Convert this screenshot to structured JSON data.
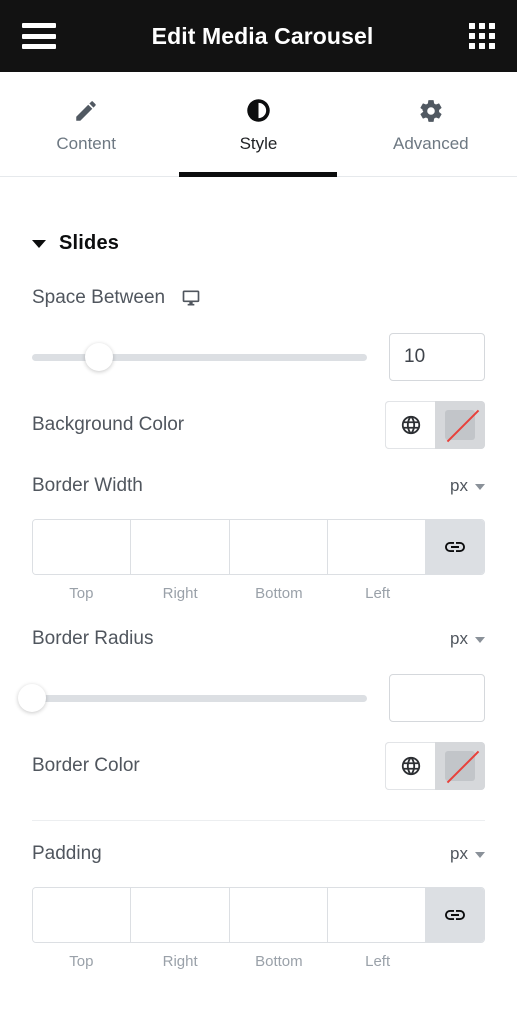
{
  "topbar": {
    "menu_icon": "hamburger-icon",
    "title": "Edit Media Carousel",
    "apps_icon": "grid-apps-icon"
  },
  "tabs": [
    {
      "id": "content",
      "label": "Content",
      "icon": "pencil-icon",
      "active": false
    },
    {
      "id": "style",
      "label": "Style",
      "icon": "contrast-half-circle-icon",
      "active": true
    },
    {
      "id": "advanced",
      "label": "Advanced",
      "icon": "gear-icon",
      "active": false
    }
  ],
  "section": {
    "title": "Slides",
    "expanded": true,
    "caret_icon": "caret-down-icon"
  },
  "controls": {
    "space_between": {
      "label": "Space Between",
      "device_icon": "desktop-monitor-icon",
      "value": "10",
      "placeholder": "",
      "slider_percent": 20
    },
    "background_color": {
      "label": "Background Color",
      "globe_icon": "globe-icon",
      "swatch_icon": "no-color-swatch-icon",
      "value": ""
    },
    "border_width": {
      "label": "Border Width",
      "unit": "px",
      "unit_chevron_icon": "chevron-down-icon",
      "fields": [
        {
          "name": "top",
          "label": "Top",
          "value": "",
          "placeholder": ""
        },
        {
          "name": "right",
          "label": "Right",
          "value": "",
          "placeholder": ""
        },
        {
          "name": "bottom",
          "label": "Bottom",
          "value": "",
          "placeholder": ""
        },
        {
          "name": "left",
          "label": "Left",
          "value": "",
          "placeholder": ""
        }
      ],
      "link_icon": "link-chain-icon"
    },
    "border_radius": {
      "label": "Border Radius",
      "unit": "px",
      "unit_chevron_icon": "chevron-down-icon",
      "value": "",
      "placeholder": "",
      "slider_percent": 0
    },
    "border_color": {
      "label": "Border Color",
      "globe_icon": "globe-icon",
      "swatch_icon": "no-color-swatch-icon",
      "value": ""
    },
    "padding": {
      "label": "Padding",
      "unit": "px",
      "unit_chevron_icon": "chevron-down-icon",
      "fields": [
        {
          "name": "top",
          "label": "Top",
          "value": "",
          "placeholder": ""
        },
        {
          "name": "right",
          "label": "Right",
          "value": "",
          "placeholder": ""
        },
        {
          "name": "bottom",
          "label": "Bottom",
          "value": "",
          "placeholder": ""
        },
        {
          "name": "left",
          "label": "Left",
          "value": "",
          "placeholder": ""
        }
      ],
      "link_icon": "link-chain-icon"
    }
  },
  "colors": {
    "topbar_bg": "#121212",
    "topbar_text": "#ffffff",
    "active_tab": "#0c0d0e",
    "label_text": "#50565e",
    "muted_text": "#9aa1a9",
    "track": "#dcdfe3",
    "no_color_line": "#e8413b"
  }
}
